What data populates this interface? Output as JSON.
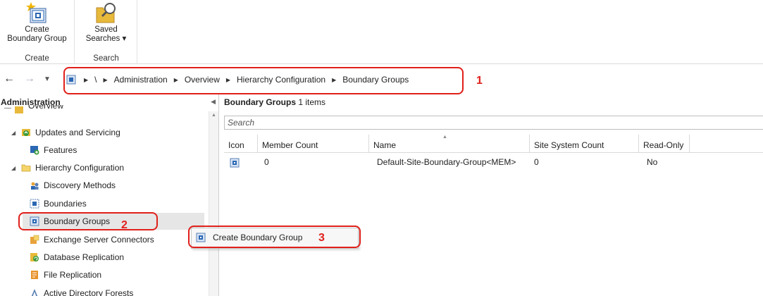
{
  "ribbon": {
    "create_group": {
      "button_label_line1": "Create",
      "button_label_line2": "Boundary Group",
      "group_label": "Create"
    },
    "search_group": {
      "button_label_line1": "Saved",
      "button_label_line2": "Searches ▾",
      "group_label": "Search"
    }
  },
  "addressbar": {
    "root": "\\",
    "crumbs": [
      "Administration",
      "Overview",
      "Hierarchy Configuration",
      "Boundary Groups"
    ],
    "callout_number": "1"
  },
  "navigation": {
    "pane_title": "Administration",
    "items": [
      {
        "label": "Overview",
        "icon": "overview-icon"
      },
      {
        "label": "Updates and Servicing",
        "icon": "updates-icon"
      },
      {
        "label": "Features",
        "icon": "features-icon"
      },
      {
        "label": "Hierarchy Configuration",
        "icon": "folder-icon"
      },
      {
        "label": "Discovery Methods",
        "icon": "discovery-icon"
      },
      {
        "label": "Boundaries",
        "icon": "boundary-icon"
      },
      {
        "label": "Boundary Groups",
        "icon": "boundary-group-icon"
      },
      {
        "label": "Exchange Server Connectors",
        "icon": "exchange-icon"
      },
      {
        "label": "Database Replication",
        "icon": "database-icon"
      },
      {
        "label": "File Replication",
        "icon": "file-replication-icon"
      },
      {
        "label": "Active Directory Forests",
        "icon": "ad-forest-icon"
      }
    ],
    "selected_callout_number": "2"
  },
  "main": {
    "title": "Boundary Groups",
    "count": "1 items",
    "search_placeholder": "Search",
    "columns": [
      "Icon",
      "Member Count",
      "Name",
      "Site System Count",
      "Read-Only"
    ],
    "rows": [
      {
        "member_count": "0",
        "name": "Default-Site-Boundary-Group<MEM>",
        "site_system_count": "0",
        "read_only": "No"
      }
    ]
  },
  "context_menu": {
    "item_label": "Create Boundary Group",
    "callout_number": "3"
  },
  "colors": {
    "callout_red": "#e0201b",
    "selection_gray": "#e6e6e6",
    "icon_blue": "#2b67b3",
    "folder_yellow": "#e8b93a"
  }
}
